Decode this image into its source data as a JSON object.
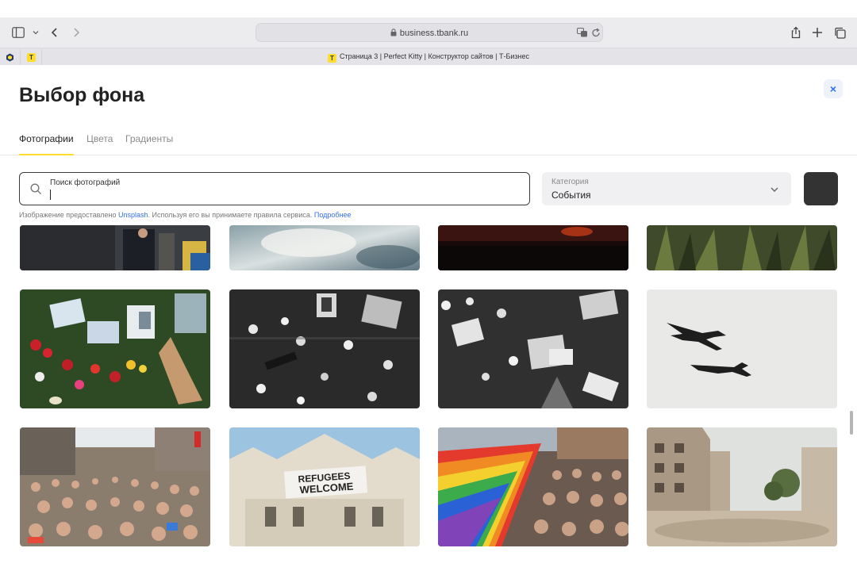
{
  "browser": {
    "url": "business.tbank.ru",
    "tab_title": "Страница 3 | Perfect Kitty | Конструктор сайтов | Т-Бизнес",
    "pinned_logo": "Т"
  },
  "modal": {
    "title": "Выбор фона",
    "close_label": "×",
    "tabs": [
      {
        "label": "Фотографии",
        "active": true
      },
      {
        "label": "Цвета",
        "active": false
      },
      {
        "label": "Градиенты",
        "active": false
      }
    ],
    "search": {
      "label": "Поиск фотографий",
      "value": ""
    },
    "category": {
      "label": "Категория",
      "value": "События"
    },
    "color_swatch": "#333333",
    "credit": {
      "prefix": "Изображение предоставлено",
      "link": "Unsplash",
      "middle": ". Используя его вы принимаете правила сервиса.",
      "more": "Подробнее"
    }
  },
  "photos": [
    {
      "description": "protest-crowd-street",
      "row": 0
    },
    {
      "description": "smoke-clouds",
      "row": 0
    },
    {
      "description": "fire-night",
      "row": 0
    },
    {
      "description": "green-grass",
      "row": 0
    },
    {
      "description": "flowers-memorial-color",
      "row": 1
    },
    {
      "description": "memorial-bw",
      "row": 1
    },
    {
      "description": "flowers-memorial-bw",
      "row": 1
    },
    {
      "description": "fighter-jets-sky",
      "row": 1
    },
    {
      "description": "pride-march-crowd",
      "row": 2
    },
    {
      "description": "refugees-welcome-banner",
      "row": 2,
      "banner_text": [
        "REFUGEES",
        "WELCOME"
      ]
    },
    {
      "description": "rainbow-flag-crowd",
      "row": 2
    },
    {
      "description": "destroyed-buildings-street",
      "row": 2
    }
  ]
}
